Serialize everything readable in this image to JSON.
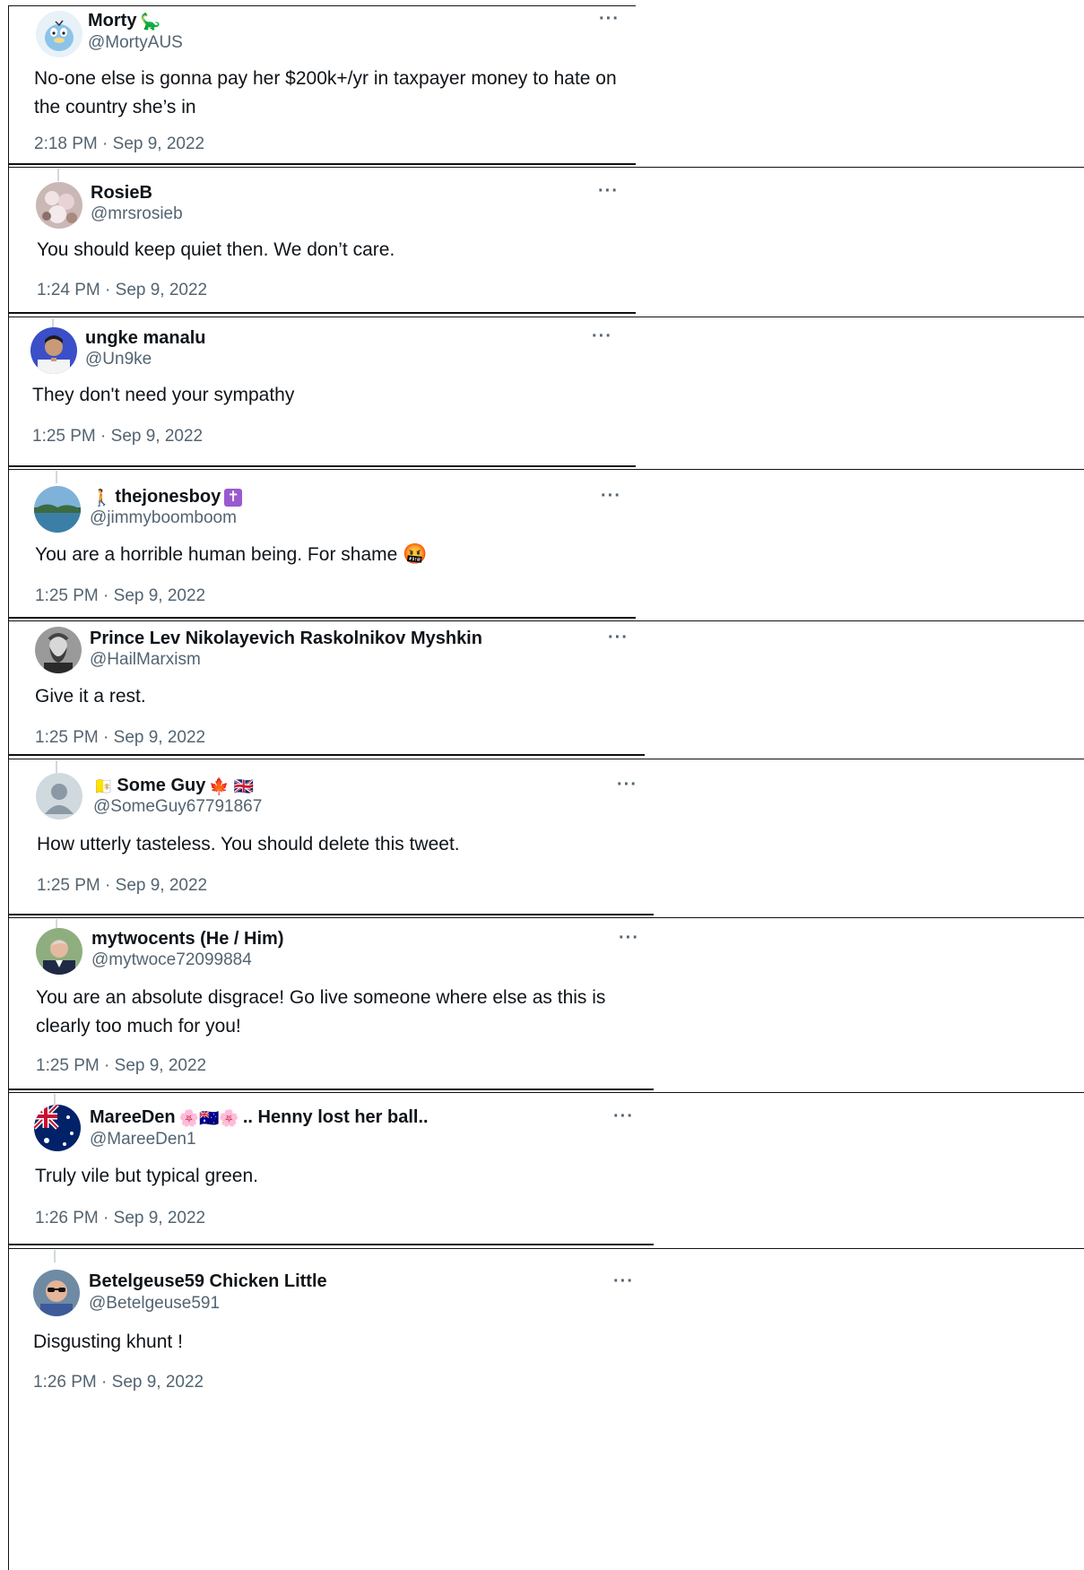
{
  "more_label": "···",
  "tweets": [
    {
      "name": "Morty",
      "name_emoji": "🦕",
      "handle": "@MortyAUS",
      "text": "No-one else is gonna pay her $200k+/yr in taxpayer money to hate on the country she’s in",
      "timestamp": "2:18 PM · Sep 9, 2022",
      "avatar_icon": "psyduck-avatar"
    },
    {
      "name": "RosieB",
      "handle": "@mrsrosieb",
      "text": "You should keep quiet then. We don’t care.",
      "timestamp": "1:24 PM · Sep 9, 2022",
      "avatar_icon": "blossom-avatar"
    },
    {
      "name": "ungke manalu",
      "handle": "@Un9ke",
      "text": "They don't need your sympathy",
      "timestamp": "1:25 PM · Sep 9, 2022",
      "avatar_icon": "person-blue-avatar"
    },
    {
      "name_prefix_emoji": "🚶",
      "name": "thejonesboy",
      "name_suffix": "✝",
      "handle": "@jimmyboomboom",
      "text": "You are a horrible human being. For shame",
      "text_emoji": "🤬",
      "timestamp": "1:25 PM · Sep 9, 2022",
      "avatar_icon": "lake-avatar"
    },
    {
      "name": "Prince Lev Nikolayevich Raskolnikov Myshkin",
      "handle": "@HailMarxism",
      "text": "Give it a rest.",
      "timestamp": "1:25 PM · Sep 9, 2022",
      "avatar_icon": "portrait-bw-avatar"
    },
    {
      "name_prefix_emoji": "🇻🇦",
      "name": "Some Guy",
      "name_emoji": "🍁 🇬🇧",
      "handle": "@SomeGuy67791867",
      "text": "How utterly tasteless. You should delete this tweet.",
      "timestamp": "1:25 PM · Sep 9, 2022",
      "avatar_icon": "default-avatar"
    },
    {
      "name": "mytwocents (He / Him)",
      "handle": "@mytwoce72099884",
      "text": "You are an absolute disgrace! Go live someone where else as this is clearly too much for you!",
      "timestamp": "1:25 PM · Sep 9, 2022",
      "avatar_icon": "man-suit-avatar"
    },
    {
      "name": "MareeDen",
      "name_emoji": "🌸🇦🇺🌸",
      "name_suffix": ".. Henny lost her ball..",
      "handle": "@MareeDen1",
      "text": "Truly vile but typical green.",
      "timestamp": "1:26 PM · Sep 9, 2022",
      "avatar_icon": "australia-flag-avatar"
    },
    {
      "name": "Betelgeuse59 Chicken Little",
      "handle": "@Betelgeuse591",
      "text": "Disgusting khunt !",
      "timestamp": "1:26 PM · Sep 9, 2022",
      "avatar_icon": "man-sunglasses-avatar"
    }
  ]
}
